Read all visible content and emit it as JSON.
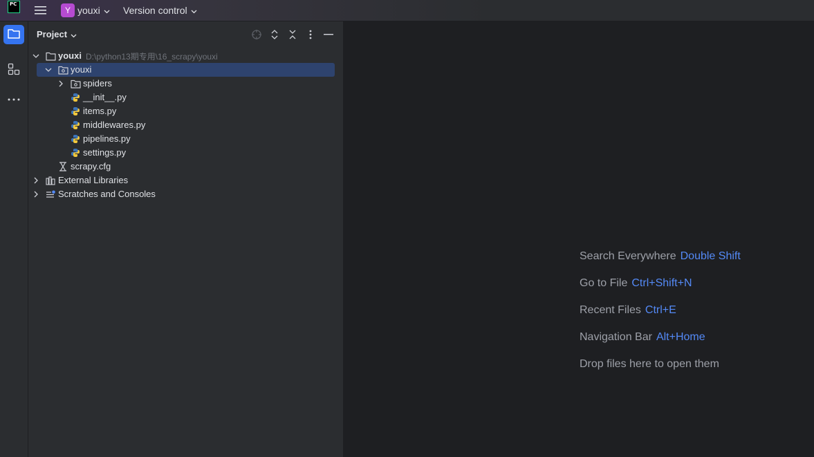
{
  "titlebar": {
    "app_logo": "PC",
    "project_badge": "Y",
    "project_name": "youxi",
    "vcs_label": "Version control"
  },
  "toolstrip": {
    "items": [
      "folder-icon",
      "structure-icon",
      "more-icon"
    ]
  },
  "panel": {
    "title": "Project"
  },
  "tree": {
    "root_name": "youxi",
    "root_path": "D:\\python13期专用\\16_scrapy\\youxi",
    "pkg_name": "youxi",
    "spiders": "spiders",
    "init": "__init__.py",
    "items": "items.py",
    "middlewares": "middlewares.py",
    "pipelines": "pipelines.py",
    "settings": "settings.py",
    "scrapy_cfg": "scrapy.cfg",
    "external_libraries": "External Libraries",
    "scratches": "Scratches and Consoles"
  },
  "editor_hints": [
    {
      "label": "Search Everywhere",
      "key": "Double Shift"
    },
    {
      "label": "Go to File",
      "key": "Ctrl+Shift+N"
    },
    {
      "label": "Recent Files",
      "key": "Ctrl+E"
    },
    {
      "label": "Navigation Bar",
      "key": "Alt+Home"
    },
    {
      "label": "Drop files here to open them",
      "key": ""
    }
  ],
  "colors": {
    "accent": "#3574f0",
    "selection": "#2e436e",
    "shortcut": "#548af7",
    "project_badge": "#b64bd1"
  }
}
